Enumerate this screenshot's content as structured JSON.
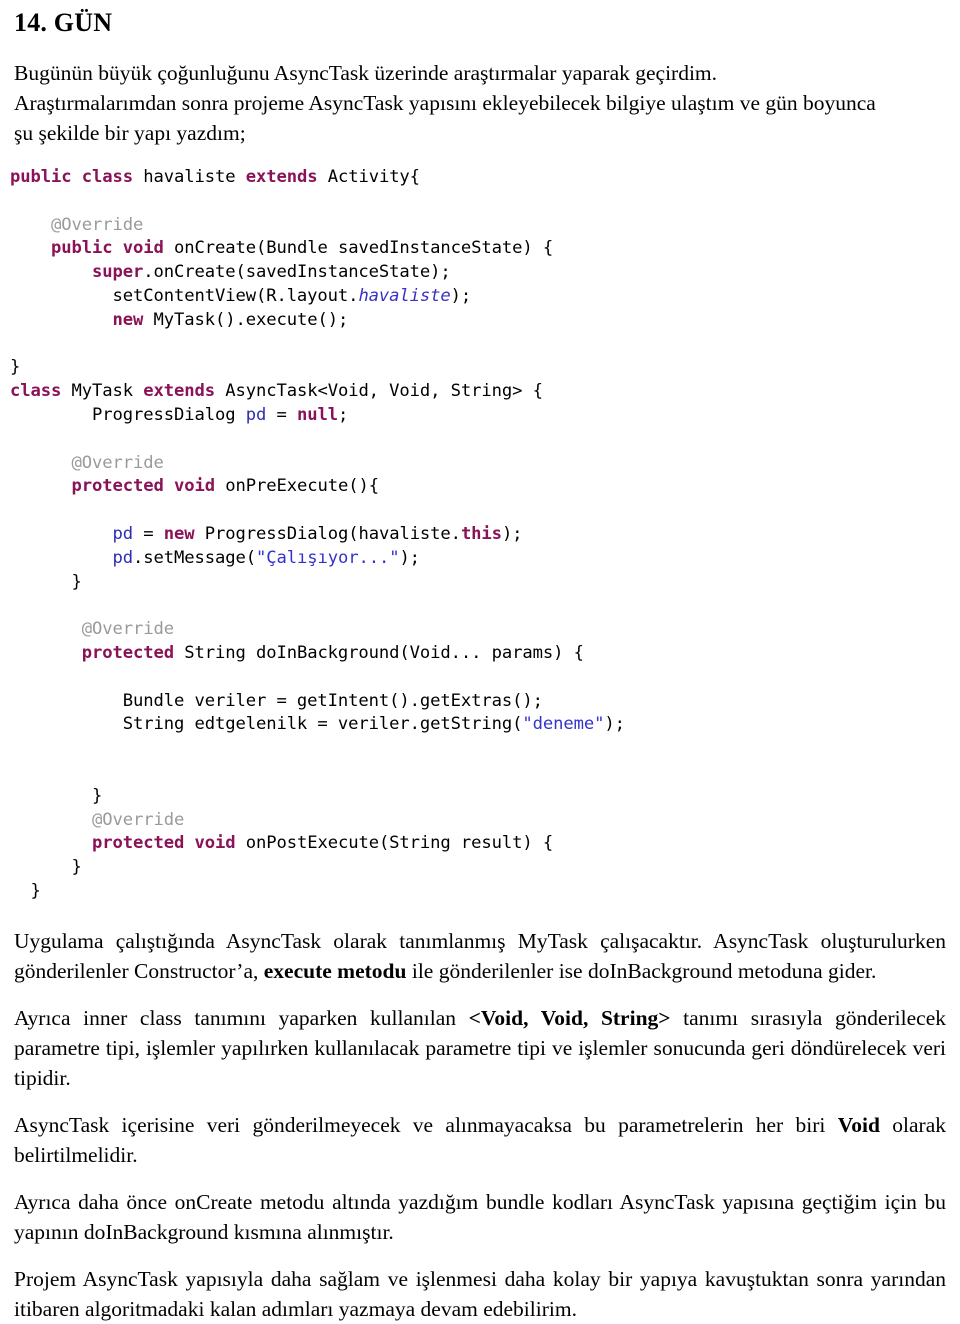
{
  "document": {
    "heading": "14. GÜN",
    "intro_paragraph_lines": [
      "Bugünün büyük çoğunluğunu AsyncTask üzerinde araştırmalar yaparak geçirdim.",
      "Araştırmalarımdan sonra projeme AsyncTask yapısını ekleyebilecek bilgiye ulaştım ve gün boyunca",
      "şu şekilde bir yapı yazdım;"
    ],
    "code_block": {
      "language": "java",
      "lines": [
        [
          {
            "t": "public ",
            "c": "kw"
          },
          {
            "t": "class ",
            "c": "kw"
          },
          {
            "t": "havaliste ",
            "c": "pln"
          },
          {
            "t": "extends ",
            "c": "kw"
          },
          {
            "t": "Activity{",
            "c": "pln"
          }
        ],
        [],
        [
          {
            "t": "    @Override",
            "c": "ann"
          }
        ],
        [
          {
            "t": "    ",
            "c": "pln"
          },
          {
            "t": "public ",
            "c": "kw"
          },
          {
            "t": "void ",
            "c": "kw"
          },
          {
            "t": "onCreate(Bundle savedInstanceState) {",
            "c": "pln"
          }
        ],
        [
          {
            "t": "        ",
            "c": "pln"
          },
          {
            "t": "super",
            "c": "kw"
          },
          {
            "t": ".onCreate(savedInstanceState);",
            "c": "pln"
          }
        ],
        [
          {
            "t": "          setContentView(R.layout.",
            "c": "pln"
          },
          {
            "t": "havaliste",
            "c": "lit"
          },
          {
            "t": ");",
            "c": "pln"
          }
        ],
        [
          {
            "t": "          ",
            "c": "pln"
          },
          {
            "t": "new ",
            "c": "kw"
          },
          {
            "t": "MyTask().execute();",
            "c": "pln"
          }
        ],
        [],
        [
          {
            "t": "}",
            "c": "pln"
          }
        ],
        [
          {
            "t": "class ",
            "c": "kw"
          },
          {
            "t": "MyTask ",
            "c": "pln"
          },
          {
            "t": "extends ",
            "c": "kw"
          },
          {
            "t": "AsyncTask<Void, Void, String> {",
            "c": "pln"
          }
        ],
        [
          {
            "t": "        ProgressDialog ",
            "c": "pln"
          },
          {
            "t": "pd",
            "c": "fld"
          },
          {
            "t": " = ",
            "c": "pln"
          },
          {
            "t": "null",
            "c": "kw"
          },
          {
            "t": ";",
            "c": "pln"
          }
        ],
        [],
        [
          {
            "t": "      @Override",
            "c": "ann"
          }
        ],
        [
          {
            "t": "      ",
            "c": "pln"
          },
          {
            "t": "protected ",
            "c": "kw"
          },
          {
            "t": "void ",
            "c": "kw"
          },
          {
            "t": "onPreExecute(){",
            "c": "pln"
          }
        ],
        [],
        [
          {
            "t": "          ",
            "c": "pln"
          },
          {
            "t": "pd",
            "c": "fld"
          },
          {
            "t": " = ",
            "c": "pln"
          },
          {
            "t": "new ",
            "c": "kw"
          },
          {
            "t": "ProgressDialog(havaliste.",
            "c": "pln"
          },
          {
            "t": "this",
            "c": "kw"
          },
          {
            "t": ");",
            "c": "pln"
          }
        ],
        [
          {
            "t": "          ",
            "c": "pln"
          },
          {
            "t": "pd",
            "c": "fld"
          },
          {
            "t": ".setMessage(",
            "c": "pln"
          },
          {
            "t": "\"Çalışıyor...\"",
            "c": "str"
          },
          {
            "t": ");",
            "c": "pln"
          }
        ],
        [
          {
            "t": "      }",
            "c": "pln"
          }
        ],
        [],
        [
          {
            "t": "       @Override",
            "c": "ann"
          }
        ],
        [
          {
            "t": "       ",
            "c": "pln"
          },
          {
            "t": "protected ",
            "c": "kw"
          },
          {
            "t": "String doInBackground(Void... params) {",
            "c": "pln"
          }
        ],
        [],
        [
          {
            "t": "           Bundle veriler = getIntent().getExtras();",
            "c": "pln"
          }
        ],
        [
          {
            "t": "           String edtgelenilk = veriler.getString(",
            "c": "pln"
          },
          {
            "t": "\"deneme\"",
            "c": "str"
          },
          {
            "t": ");",
            "c": "pln"
          }
        ],
        [],
        [],
        [
          {
            "t": "        }",
            "c": "pln"
          }
        ],
        [
          {
            "t": "        @Override",
            "c": "ann"
          }
        ],
        [
          {
            "t": "        ",
            "c": "pln"
          },
          {
            "t": "protected ",
            "c": "kw"
          },
          {
            "t": "void ",
            "c": "kw"
          },
          {
            "t": "onPostExecute(String result) {",
            "c": "pln"
          }
        ],
        [
          {
            "t": "      }",
            "c": "pln"
          }
        ],
        [
          {
            "t": "  }",
            "c": "pln"
          }
        ]
      ]
    },
    "paragraphs": [
      {
        "id": "p-asynctask-mytask",
        "runs": [
          {
            "t": "Uygulama çalıştığında AsyncTask olarak tanımlanmış MyTask çalışacaktır. AsyncTask oluşturulurken gönderilenler Constructor’a, ",
            "b": false
          },
          {
            "t": "execute metodu",
            "b": true
          },
          {
            "t": " ile gönderilenler ise doInBackground metoduna gider.",
            "b": false
          }
        ]
      },
      {
        "id": "p-generic-params",
        "runs": [
          {
            "t": "Ayrıca inner class tanımını yaparken kullanılan ",
            "b": false
          },
          {
            "t": "<Void, Void, String>",
            "b": true
          },
          {
            "t": " tanımı sırasıyla gönderilecek parametre tipi, işlemler yapılırken kullanılacak parametre tipi ve işlemler sonucunda geri döndürelecek veri tipidir.",
            "b": false
          }
        ]
      },
      {
        "id": "p-void-note",
        "runs": [
          {
            "t": "AsyncTask içerisine veri gönderilmeyecek ve alınmayacaksa bu parametrelerin her biri ",
            "b": false
          },
          {
            "t": "Void",
            "b": true
          },
          {
            "t": " olarak belirtilmelidir.",
            "b": false
          }
        ]
      },
      {
        "id": "p-bundle-moved",
        "runs": [
          {
            "t": "Ayrıca daha önce onCreate metodu altında yazdığım bundle kodları AsyncTask yapısına geçtiğim için bu yapının doInBackground kısmına alınmıştır.",
            "b": false
          }
        ]
      },
      {
        "id": "p-closing",
        "runs": [
          {
            "t": "Projem AsyncTask yapısıyla daha sağlam ve işlenmesi daha kolay bir yapıya kavuştuktan sonra yarından itibaren algoritmadaki kalan adımları yazmaya devam edebilirim.",
            "b": false
          }
        ]
      }
    ],
    "colors": {
      "keyword": "#8a1358",
      "annotation": "#9a9a9a",
      "string": "#3333cc",
      "field": "#2d2db5",
      "literal_italic": "#3a31c4",
      "text": "#000000",
      "background": "#ffffff"
    }
  }
}
